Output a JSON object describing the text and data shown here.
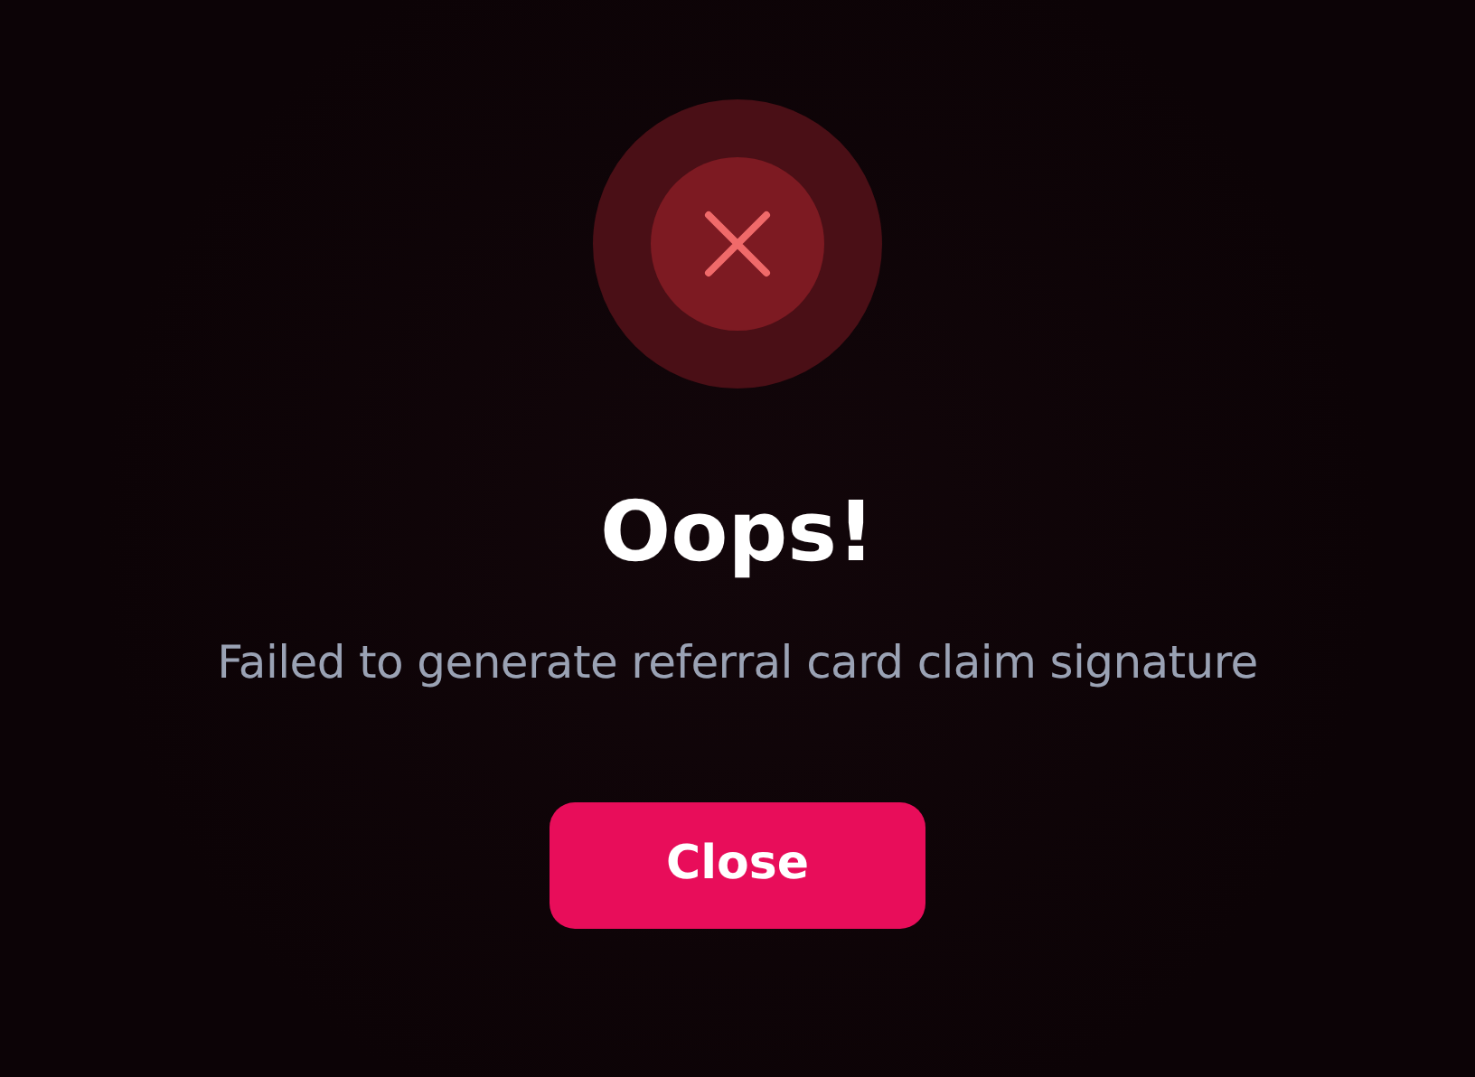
{
  "dialog": {
    "title": "Oops!",
    "message": "Failed to generate referral card claim signature",
    "buttons": [
      {
        "label": "Close",
        "kind": "primary"
      }
    ]
  }
}
